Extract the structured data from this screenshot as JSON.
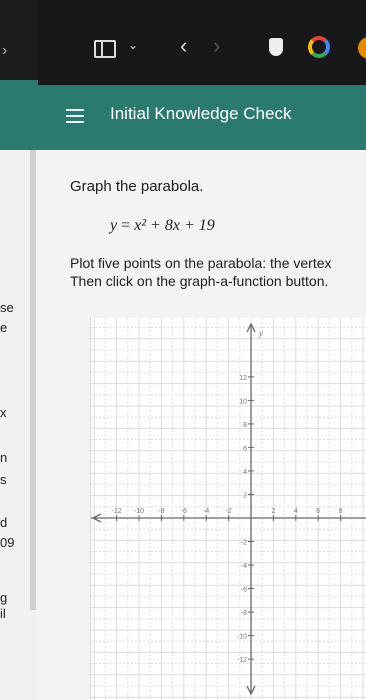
{
  "left_tab": {
    "fragments": [
      "se",
      "e",
      "x",
      "n",
      "s",
      "d",
      "09",
      "g",
      "il"
    ]
  },
  "toolbar": {
    "icons": [
      "sidebar-icon",
      "chevron-down-icon",
      "back-icon",
      "forward-icon",
      "shield-icon",
      "google-icon",
      "extension-icon"
    ]
  },
  "header": {
    "title": "Initial Knowledge Check",
    "menu_icon": "hamburger-icon",
    "background": "#2a7a6f"
  },
  "question": {
    "prompt": "Graph the parabola.",
    "equation_lhs": "y",
    "equation_rhs": "x² + 8x + 19",
    "instruction_line1": "Plot five points on the parabola: the vertex",
    "instruction_line2": "Then click on the graph-a-function button."
  },
  "graph": {
    "x_ticks": [
      "-12",
      "-10",
      "-8",
      "-6",
      "-4",
      "-2",
      "2",
      "4",
      "6",
      "8"
    ],
    "y_ticks": [
      "12",
      "10",
      "8",
      "6",
      "4",
      "2",
      "-2",
      "-4",
      "-6",
      "-8",
      "-10",
      "-12"
    ],
    "y_axis_label": "y"
  }
}
